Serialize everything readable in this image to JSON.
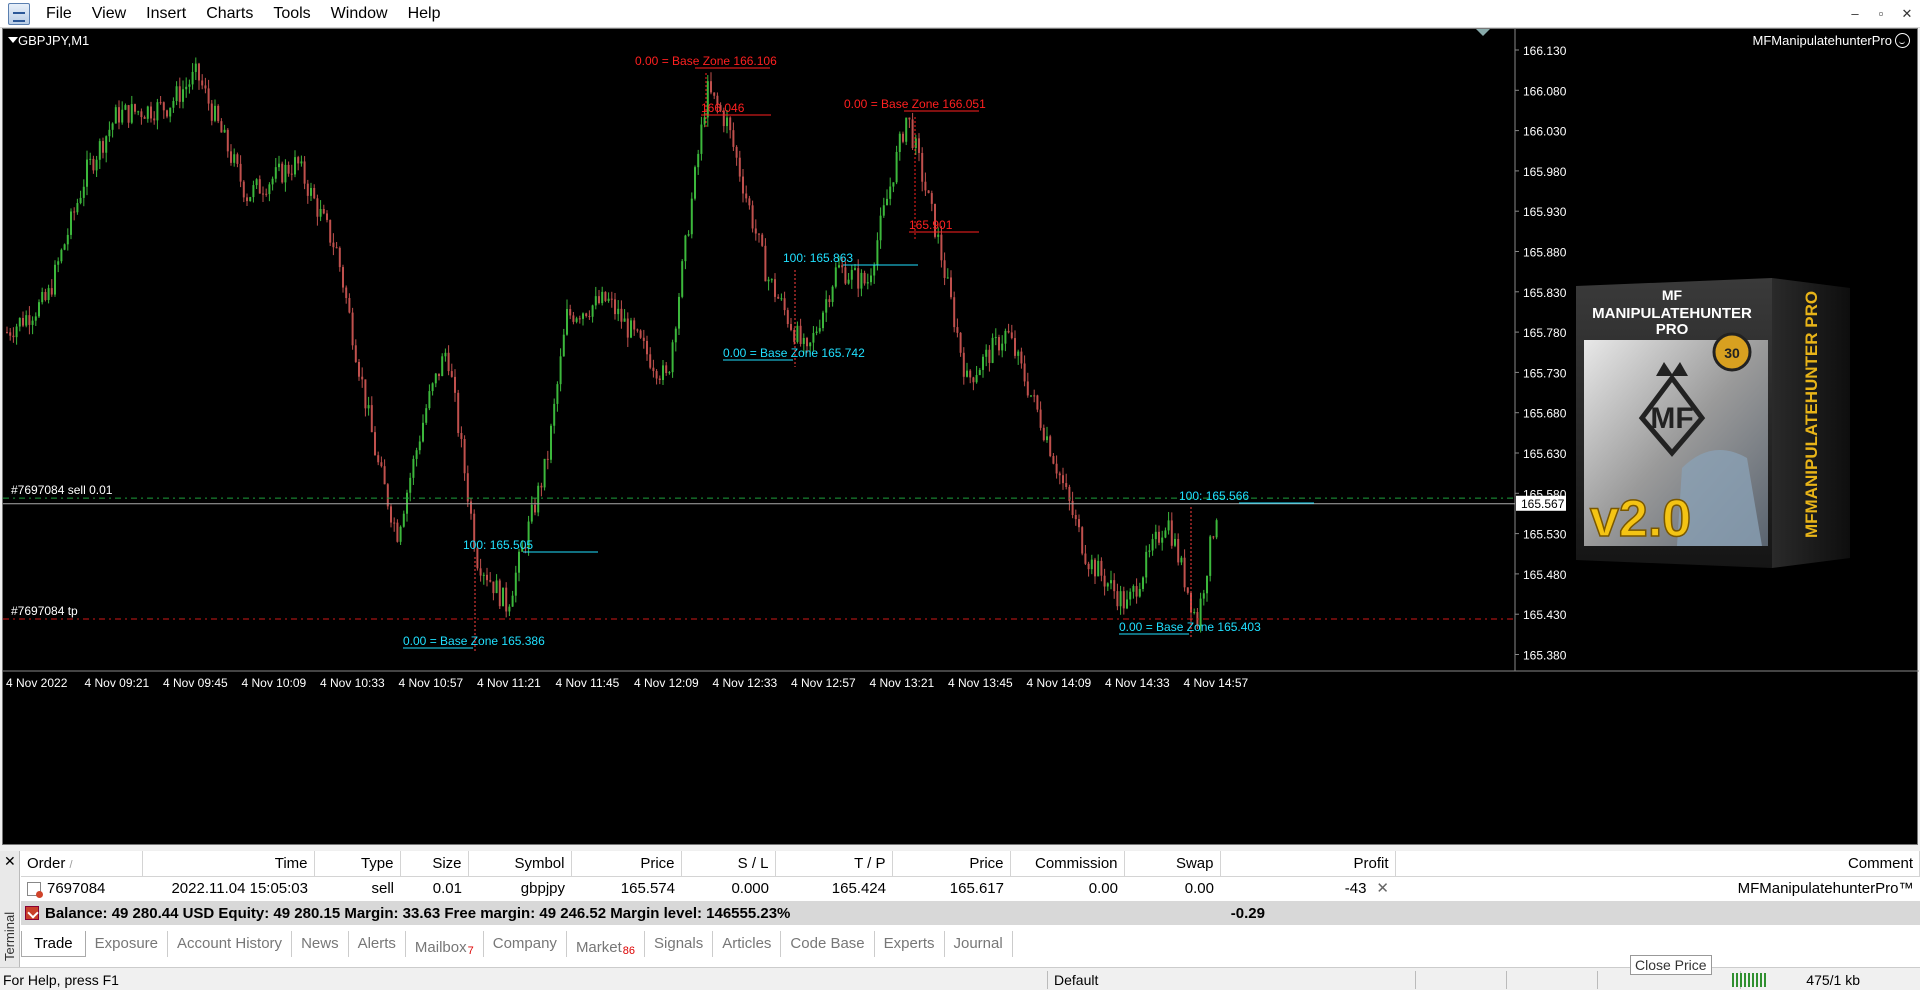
{
  "menu": [
    "File",
    "View",
    "Insert",
    "Charts",
    "Tools",
    "Window",
    "Help"
  ],
  "window_controls": [
    "–",
    "▫",
    "✕"
  ],
  "chart": {
    "symbol": "GBPJPY,M1",
    "ea_name": "MFManipulatehunterPro",
    "current_price": "165.567",
    "price_axis": [
      "166.130",
      "166.080",
      "166.030",
      "165.980",
      "165.930",
      "165.880",
      "165.830",
      "165.780",
      "165.730",
      "165.680",
      "165.630",
      "165.580",
      "165.530",
      "165.480",
      "165.430",
      "165.380"
    ],
    "time_axis": [
      "4 Nov 2022",
      "4 Nov 09:21",
      "4 Nov 09:45",
      "4 Nov 10:09",
      "4 Nov 10:33",
      "4 Nov 10:57",
      "4 Nov 11:21",
      "4 Nov 11:45",
      "4 Nov 12:09",
      "4 Nov 12:33",
      "4 Nov 12:57",
      "4 Nov 13:21",
      "4 Nov 13:45",
      "4 Nov 14:09",
      "4 Nov 14:33",
      "4 Nov 14:57"
    ],
    "order_line_label": "#7697084 sell 0.01",
    "tp_line_label": "#7697084 tp",
    "annotations": [
      {
        "text": "0.00 = Base Zone   166.106",
        "color": "#ff2020"
      },
      {
        "text": "166.046",
        "color": "#ff2020"
      },
      {
        "text": "0.00 = Base Zone   166.051",
        "color": "#ff2020"
      },
      {
        "text": "165.901",
        "color": "#ff2020"
      },
      {
        "text": "100:   165.863",
        "color": "#20e0ff"
      },
      {
        "text": "0.00 = Base Zone   165.742",
        "color": "#20e0ff"
      },
      {
        "text": "100:   165.505",
        "color": "#20e0ff"
      },
      {
        "text": "0.00 = Base Zone   165.386",
        "color": "#20e0ff"
      },
      {
        "text": "100:   165.566",
        "color": "#20e0ff"
      },
      {
        "text": "0.00 = Base Zone   165.403",
        "color": "#20e0ff"
      }
    ],
    "colors": {
      "bull": "#3cb83c",
      "bear": "#c0504d",
      "sell_line": "#1e9e3c",
      "tp_line": "#d01818",
      "bid_line": "#aaaaaa"
    }
  },
  "product_box": {
    "brand": "MF",
    "title_line1": "MANIPULATEHUNTER",
    "title_line2": "PRO",
    "side_text": "MFMANIPULATEHUNTER PRO",
    "version": "v2.0",
    "badge": "30"
  },
  "terminal": {
    "side_label": "Terminal",
    "columns": [
      "Order",
      "Time",
      "Type",
      "Size",
      "Symbol",
      "Price",
      "S / L",
      "T / P",
      "Price",
      "Commission",
      "Swap",
      "Profit",
      "Comment"
    ],
    "sort_indicator": "/",
    "rows": [
      {
        "order": "7697084",
        "time": "2022.11.04 15:05:03",
        "type": "sell",
        "size": "0.01",
        "symbol": "gbpjpy",
        "price": "165.574",
        "sl": "0.000",
        "tp": "165.424",
        "cur_price": "165.617",
        "commission": "0.00",
        "swap": "0.00",
        "profit": "-43",
        "comment": "MFManipulatehunterPro™"
      }
    ],
    "balance_text": "Balance: 49 280.44 USD  Equity: 49 280.15  Margin: 33.63  Free margin: 49 246.52  Margin level: 146555.23%",
    "balance_profit": "-0.29",
    "tabs": [
      {
        "label": "Trade",
        "badge": ""
      },
      {
        "label": "Exposure",
        "badge": ""
      },
      {
        "label": "Account History",
        "badge": ""
      },
      {
        "label": "News",
        "badge": ""
      },
      {
        "label": "Alerts",
        "badge": ""
      },
      {
        "label": "Mailbox",
        "badge": "7"
      },
      {
        "label": "Company",
        "badge": ""
      },
      {
        "label": "Market",
        "badge": "86"
      },
      {
        "label": "Signals",
        "badge": ""
      },
      {
        "label": "Articles",
        "badge": ""
      },
      {
        "label": "Code Base",
        "badge": ""
      },
      {
        "label": "Experts",
        "badge": ""
      },
      {
        "label": "Journal",
        "badge": ""
      }
    ]
  },
  "status": {
    "help": "For Help, press F1",
    "profile": "Default",
    "traffic": "475/1 kb",
    "tooltip": "Close Price"
  }
}
